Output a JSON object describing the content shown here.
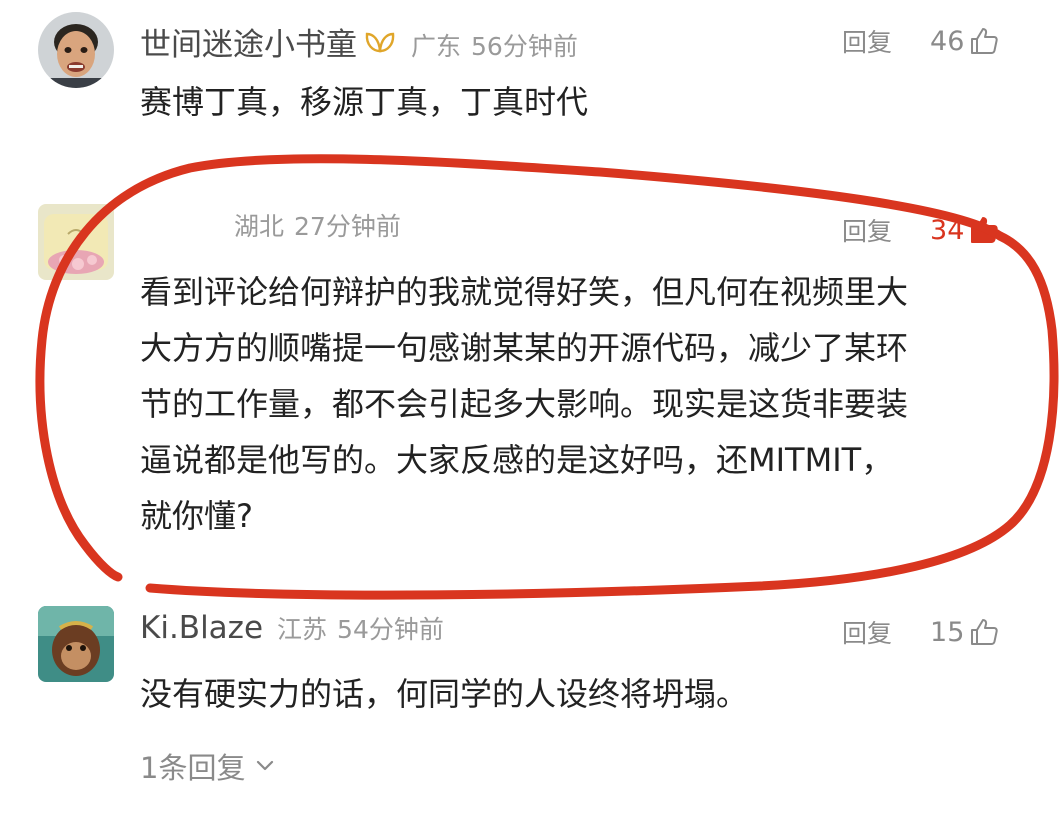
{
  "comments": [
    {
      "username": "世间迷途小书童",
      "location": "广东",
      "time": "56分钟前",
      "reply_label": "回复",
      "likes": "46",
      "text": "赛博丁真，移源丁真，丁真时代"
    },
    {
      "username": "",
      "location": "湖北",
      "time": "27分钟前",
      "reply_label": "回复",
      "likes": "34",
      "text_lines": [
        "看到评论给何辩护的我就觉得好笑，但凡何在视频里大",
        "大方方的顺嘴提一句感谢某某的开源代码，减少了某环",
        "节的工作量，都不会引起多大影响。现实是这货非要装",
        "逼说都是他写的。大家反感的是这好吗，还MITMIT，",
        "就你懂?"
      ]
    },
    {
      "username": "Ki.Blaze",
      "location": "江苏",
      "time": "54分钟前",
      "reply_label": "回复",
      "likes": "15",
      "text": "没有硬实力的话，何同学的人设终将坍塌。",
      "replies_link": "1条回复"
    }
  ],
  "colors": {
    "annotation_stroke": "#d9351f",
    "muted_text": "#8a8a8a",
    "body_text": "#222222",
    "badge": "#e0a62a"
  },
  "icons": {
    "like": "thumbs-up-icon",
    "badge": "wing-badge-icon",
    "chevron": "chevron-down-icon"
  }
}
